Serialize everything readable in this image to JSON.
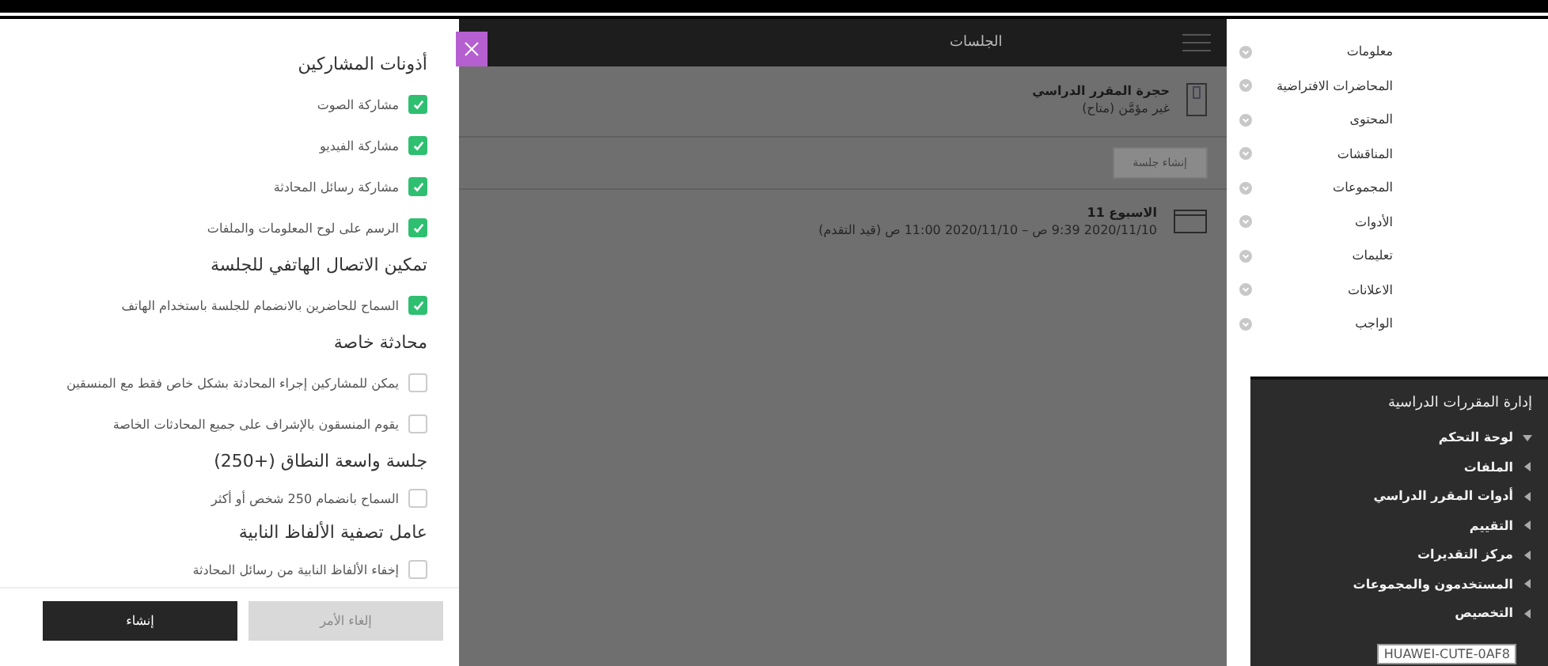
{
  "settings_panel": {
    "sections": [
      {
        "title": "أذونات المشاركين",
        "options": [
          {
            "label": "مشاركة الصوت",
            "checked": true
          },
          {
            "label": "مشاركة الفيديو",
            "checked": true
          },
          {
            "label": "مشاركة رسائل المحادثة",
            "checked": true
          },
          {
            "label": "الرسم على لوح المعلومات والملفات",
            "checked": true
          }
        ]
      },
      {
        "title": "تمكين الاتصال الهاتفي للجلسة",
        "options": [
          {
            "label": "السماح للحاضرين بالانضمام للجلسة باستخدام الهاتف",
            "checked": true
          }
        ]
      },
      {
        "title": "محادثة خاصة",
        "options": [
          {
            "label": "يمكن للمشاركين إجراء المحادثة بشكل خاص فقط مع المنسقين",
            "checked": false
          },
          {
            "label": "يقوم المنسقون بالإشراف على جميع المحادثات الخاصة",
            "checked": false
          }
        ]
      },
      {
        "title": "جلسة واسعة النطاق (+250)",
        "options": [
          {
            "label": "السماح بانضمام 250 شخص أو أكثر",
            "checked": false
          }
        ]
      },
      {
        "title": "عامل تصفية الألفاظ النابية",
        "options": [
          {
            "label": "إخفاء الألفاظ النابية من رسائل المحادثة",
            "checked": false
          }
        ]
      }
    ],
    "buttons": [
      {
        "label": "إلغاء الأمر",
        "kind": "secondary"
      },
      {
        "label": "إنشاء",
        "kind": "primary"
      }
    ]
  },
  "sessions": {
    "title": "الجلسات",
    "room": {
      "name": "حجرة المقرر الدراسي",
      "status": "غير مؤمَّن (متاح)"
    },
    "create_button": "إنشاء جلسة",
    "items": [
      {
        "name": "الاسبوع 11",
        "time": "2020/11/10 9:39 ص – 2020/11/10 11:00 ص (قيد التقدم)"
      }
    ]
  },
  "course_menu": {
    "items": [
      "معلومات",
      "المحاضرات الافتراضية",
      "المحتوى",
      "المناقشات",
      "المجموعات",
      "الأدوات",
      "تعليمات",
      "الاعلانات",
      "الواجب"
    ]
  },
  "management": {
    "title": "إدارة المقررات الدراسية",
    "items": [
      {
        "label": "لوحة التحكم",
        "expanded": true
      },
      {
        "label": "الملفات",
        "expanded": false
      },
      {
        "label": "أدوات المقرر الدراسي",
        "expanded": false
      },
      {
        "label": "التقييم",
        "expanded": false
      },
      {
        "label": "مركز التقديرات",
        "expanded": false
      },
      {
        "label": "المستخدمون والمجموعات",
        "expanded": false
      },
      {
        "label": "التخصيص",
        "expanded": false
      }
    ]
  },
  "tooltip": "HUAWEI-CUTE-0AF8"
}
